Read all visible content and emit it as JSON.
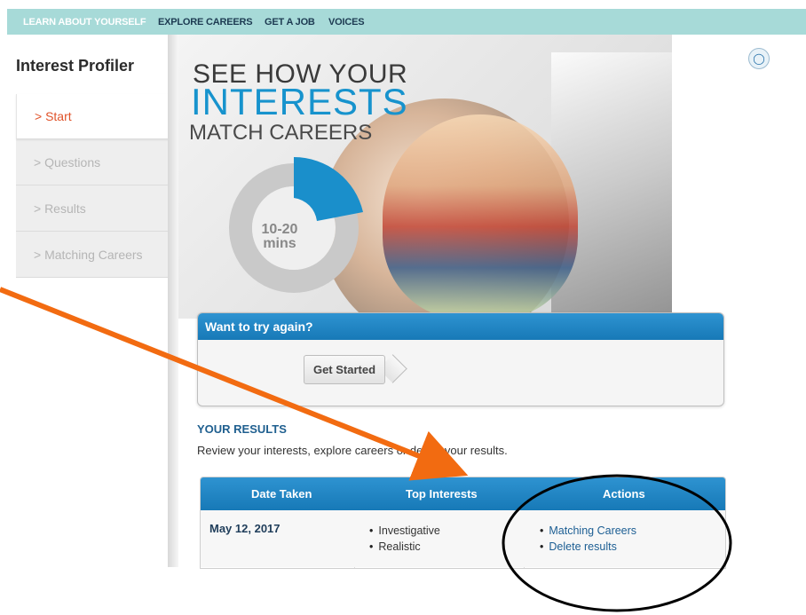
{
  "topnav": {
    "items": [
      "LEARN ABOUT YOURSELF",
      "EXPLORE CAREERS",
      "GET A JOB",
      "VOICES"
    ]
  },
  "sidebar": {
    "title": "Interest Profiler",
    "steps": [
      "> Start",
      "> Questions",
      "> Results",
      "> Matching Careers"
    ]
  },
  "hero": {
    "line1": "SEE HOW YOUR",
    "line2": "INTERESTS",
    "line3": "MATCH CAREERS",
    "duration_top": "10-20",
    "duration_bottom": "mins"
  },
  "try_again": {
    "title": "Want to try again?",
    "button": "Get Started"
  },
  "results": {
    "title": "YOUR RESULTS",
    "description": "Review your interests, explore careers or delete your results.",
    "columns": [
      "Date Taken",
      "Top Interests",
      "Actions"
    ],
    "rows": [
      {
        "date": "May 12, 2017",
        "interests": [
          "Investigative",
          "Realistic"
        ],
        "actions": [
          "Matching Careers",
          "Delete results"
        ]
      }
    ]
  },
  "icons": {
    "help": "lightbulb-icon"
  },
  "colors": {
    "nav_bg": "#a7dad8",
    "accent_blue": "#1793cd",
    "header_blue": "#1779b7",
    "active_step": "#e0532a",
    "annotation_arrow": "#f26b11"
  }
}
